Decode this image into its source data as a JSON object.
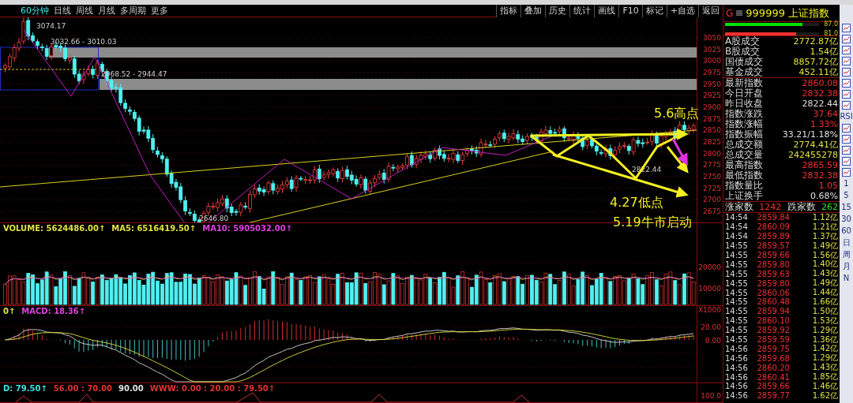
{
  "period_tabs": [
    {
      "label": "60分钟",
      "selected": true
    },
    {
      "label": "日线",
      "selected": false
    },
    {
      "label": "周线",
      "selected": false
    },
    {
      "label": "月线",
      "selected": false
    },
    {
      "label": "多周期",
      "selected": false
    },
    {
      "label": "更多",
      "selected": false
    }
  ],
  "toolbar": [
    "指标",
    "叠加",
    "历史",
    "统计",
    "画线",
    "F10",
    "标记",
    "+自选",
    "返回"
  ],
  "price_chart": {
    "axis": [
      "3050",
      "3025",
      "3000",
      "2975",
      "2950",
      "2925",
      "2900",
      "2875",
      "2850",
      "2825",
      "2800",
      "2775",
      "2750",
      "2725",
      "2700",
      "2675"
    ],
    "labels": [
      "3074.17",
      "3032.66 - 3010.03",
      "2968.52 - 2944.47",
      "2646.80",
      "2822.44"
    ],
    "annotations": [
      "5.6高点",
      "4.27低点",
      "5.19牛市启动"
    ]
  },
  "volume": {
    "indicators": [
      {
        "text": "VOLUME: 5624486.00↑",
        "color": "#e0e040"
      },
      {
        "text": "MA5: 6516419.50↑",
        "color": "#e0e040"
      },
      {
        "text": "MA10: 5905032.00↑",
        "color": "#e040e0"
      }
    ],
    "axis": [
      "20000",
      "10000",
      "X1000"
    ]
  },
  "macd": {
    "indicators": [
      {
        "text": "0↑",
        "color": "#e0e040"
      },
      {
        "text": "MACD: 18.36↑",
        "color": "#e040e0"
      }
    ],
    "axis": [
      "20.00",
      "0.00"
    ]
  },
  "kdj": {
    "indicators": [
      {
        "text": "D: 79.50↑",
        "color": "#40e0e0"
      },
      {
        "text": "56.00 : 70.00",
        "color": "#e03030"
      },
      {
        "text": "90.00",
        "color": "#e0e0e0"
      },
      {
        "text": "WWW: 0.00 : 20.00 : 79.50↑",
        "color": "#e03030"
      }
    ],
    "axis": [
      "100.0"
    ]
  },
  "quote": {
    "marker": "G",
    "code": "999999",
    "name": "上证指数",
    "gauges": [
      {
        "level": 0.82,
        "reading": "87.0",
        "color": "#00e000"
      },
      {
        "level": 0.76,
        "reading": "81.0",
        "color": "#f03030"
      }
    ],
    "volumes": [
      {
        "label": "A股成交",
        "value": "2772.87亿"
      },
      {
        "label": "B股成交",
        "value": "1.54亿"
      },
      {
        "label": "国债成交",
        "value": "8857.72亿"
      },
      {
        "label": "基金成交",
        "value": "452.11亿"
      }
    ],
    "stats": [
      {
        "label": "最新指数",
        "value": "2860.08",
        "color": "#f03030"
      },
      {
        "label": "今日开盘",
        "value": "2832.38",
        "color": "#f03030"
      },
      {
        "label": "昨日收盘",
        "value": "2822.44",
        "color": "#e0e0e0"
      },
      {
        "label": "指数涨跌",
        "value": "37.64",
        "color": "#f03030"
      },
      {
        "label": "指数涨幅",
        "value": "1.33%",
        "color": "#f03030"
      },
      {
        "label": "指数振幅",
        "value": "33.21/1.18%",
        "color": "#e0e0e0"
      },
      {
        "label": "总成交额",
        "value": "2774.41亿",
        "color": "#e0e040"
      },
      {
        "label": "总成交量",
        "value": "242455278",
        "color": "#e0e040"
      },
      {
        "label": "最高指数",
        "value": "2865.59",
        "color": "#f03030"
      },
      {
        "label": "最低指数",
        "value": "2832.38",
        "color": "#f03030"
      },
      {
        "label": "指数量比",
        "value": "1.05",
        "color": "#f03030"
      },
      {
        "label": "上证换手",
        "value": "0.68%",
        "color": "#e0e0e0"
      }
    ],
    "breadth": {
      "up_label": "涨家数",
      "up": "1242",
      "down_label": "跌家数",
      "down": "262"
    },
    "ticks": [
      {
        "time": "14:54",
        "price": "2859.84",
        "amount": "1.12亿"
      },
      {
        "time": "14:54",
        "price": "2860.09",
        "amount": "1.21亿"
      },
      {
        "time": "14:54",
        "price": "2859.89",
        "amount": "1.37亿"
      },
      {
        "time": "14:55",
        "price": "2859.57",
        "amount": "1.49亿"
      },
      {
        "time": "14:55",
        "price": "2859.66",
        "amount": "1.56亿"
      },
      {
        "time": "14:55",
        "price": "2859.80",
        "amount": "1.40亿"
      },
      {
        "time": "14:55",
        "price": "2859.63",
        "amount": "1.43亿"
      },
      {
        "time": "14:55",
        "price": "2859.80",
        "amount": "1.49亿"
      },
      {
        "time": "14:55",
        "price": "2860.06",
        "amount": "1.44亿"
      },
      {
        "time": "14:55",
        "price": "2860.48",
        "amount": "1.66亿"
      },
      {
        "time": "14:55",
        "price": "2859.94",
        "amount": "1.50亿"
      },
      {
        "time": "14:55",
        "price": "2860.10",
        "amount": "1.53亿"
      },
      {
        "time": "14:55",
        "price": "2859.92",
        "amount": "1.29亿"
      },
      {
        "time": "14:55",
        "price": "2859.59",
        "amount": "1.36亿"
      },
      {
        "time": "14:56",
        "price": "2859.75",
        "amount": "1.42亿"
      },
      {
        "time": "14:56",
        "price": "2859.68",
        "amount": "1.29亿"
      },
      {
        "time": "14:56",
        "price": "2860.20",
        "amount": "1.43亿"
      },
      {
        "time": "14:56",
        "price": "2860.41",
        "amount": "1.85亿"
      },
      {
        "time": "14:56",
        "price": "2859.66",
        "amount": "1.46亿"
      },
      {
        "time": "14:56",
        "price": "2859.77",
        "amount": "1.62亿"
      }
    ]
  },
  "sidebar": [
    {
      "kind": "icon"
    },
    {
      "kind": "icon"
    },
    {
      "kind": "icon"
    },
    {
      "kind": "icon"
    },
    {
      "kind": "icon"
    },
    {
      "kind": "icon"
    },
    {
      "kind": "icon"
    },
    {
      "kind": "icon"
    },
    {
      "kind": "text",
      "label": "RSI"
    },
    {
      "kind": "icon"
    },
    {
      "kind": "icon"
    },
    {
      "kind": "icon"
    },
    {
      "kind": "icon"
    },
    {
      "kind": "icon"
    },
    {
      "kind": "text",
      "label": "1"
    },
    {
      "kind": "text",
      "label": "5"
    },
    {
      "kind": "text",
      "label": "15"
    },
    {
      "kind": "text",
      "label": "30"
    },
    {
      "kind": "text",
      "label": "60"
    },
    {
      "kind": "text",
      "label": "日"
    },
    {
      "kind": "text",
      "label": "周"
    },
    {
      "kind": "text",
      "label": "月"
    },
    {
      "kind": "text",
      "label": "N"
    }
  ]
}
